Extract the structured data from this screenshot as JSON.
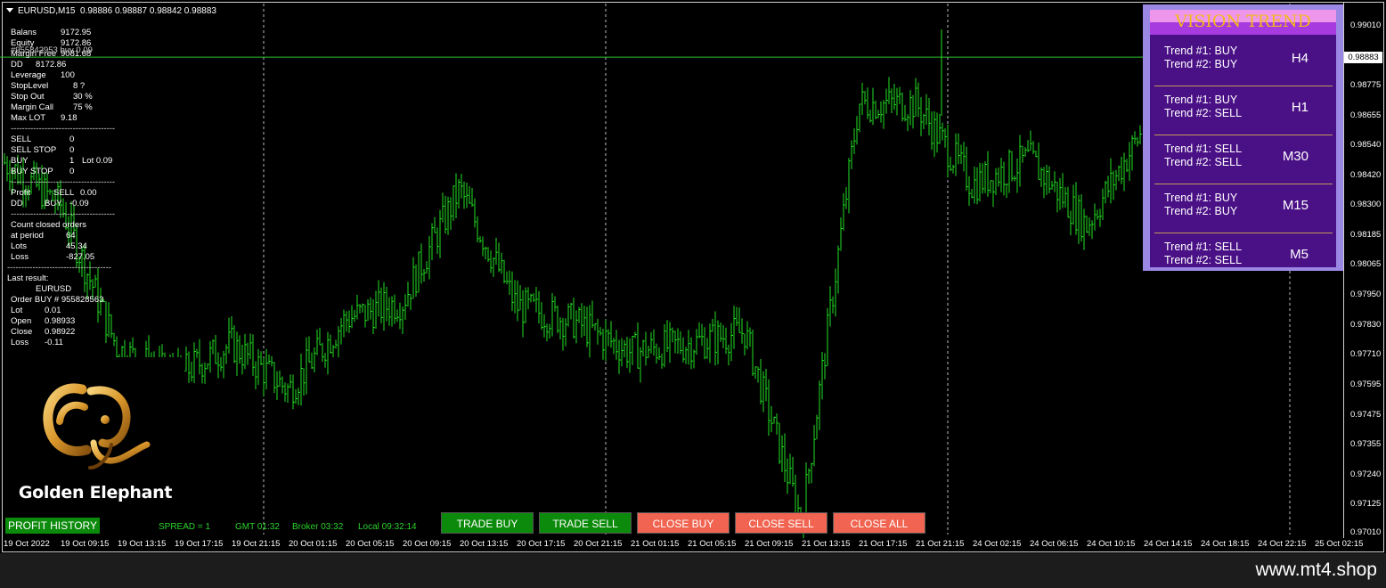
{
  "header": {
    "symbol": "EURUSD,M15",
    "quotes": "0.98886 0.98887 0.98842 0.98883"
  },
  "account": {
    "rows": [
      {
        "label": "Balans",
        "value": "9172.95"
      },
      {
        "label": "Equity",
        "value": "9172.86"
      },
      {
        "label": "Margin Free",
        "value": "9081.68"
      },
      {
        "label": "DD",
        "value": "8172.86"
      },
      {
        "label": "Leverage",
        "value": "100"
      },
      {
        "label": "StopLevel",
        "value": "8 ?"
      },
      {
        "label": "Stop Out",
        "value": "30 %"
      },
      {
        "label": "Margin Call",
        "value": "75 %"
      },
      {
        "label": "Max LOT",
        "value": "9.18"
      }
    ],
    "overlay_text": "#955842953 buy 0.09",
    "orders": [
      {
        "label": "SELL",
        "value": "0",
        "extra": ""
      },
      {
        "label": "SELL STOP",
        "value": "0",
        "extra": ""
      },
      {
        "label": "BUY",
        "value": "1",
        "extra": "Lot  0.09"
      },
      {
        "label": "BUY STOP",
        "value": "0",
        "extra": ""
      }
    ],
    "profit": {
      "label": "Profit",
      "side": "SELL",
      "value": "0.00"
    },
    "dd": {
      "label": "DD",
      "side": "BUY",
      "value": "-0.09"
    },
    "closed_title": "Count closed orders",
    "closed": [
      {
        "label": "at period",
        "value": "64"
      },
      {
        "label": "Lots",
        "value": "45.34"
      },
      {
        "label": "Loss",
        "value": "-827.05"
      }
    ],
    "last_title": "Last result:",
    "last_symbol": "EURUSD",
    "last_order": "Order  BUY   # 955828563",
    "last": [
      {
        "label": "Lot",
        "value": "0.01"
      },
      {
        "label": "Open",
        "value": "0.98933"
      },
      {
        "label": "Close",
        "value": "0.98922"
      },
      {
        "label": "Loss",
        "value": "-0.11"
      }
    ],
    "separator": "-------------------------------------"
  },
  "logo": {
    "text": "Golden Elephant",
    "gold": "#e0a430"
  },
  "bottom_bar": {
    "profit_history": "PROFIT HISTORY",
    "spread": "SPREAD = 1",
    "gmt": "GMT 01:32",
    "broker": "Broker 03:32",
    "local": "Local 09:32:14",
    "buttons": [
      "TRADE BUY",
      "TRADE SELL",
      "CLOSE BUY",
      "CLOSE SELL",
      "CLOSE ALL"
    ]
  },
  "vision_trend": {
    "title": "VISION TREND",
    "rows": [
      {
        "t1": "Trend #1: BUY",
        "t2": "Trend #2: BUY",
        "tf": "H4"
      },
      {
        "t1": "Trend #1: BUY",
        "t2": "Trend #2: SELL",
        "tf": "H1"
      },
      {
        "t1": "Trend #1: SELL",
        "t2": "Trend #2: SELL",
        "tf": "M30"
      },
      {
        "t1": "Trend #1: BUY",
        "t2": "Trend #2: BUY",
        "tf": "M15"
      },
      {
        "t1": "Trend #1: SELL",
        "t2": "Trend #2: SELL",
        "tf": "M5"
      }
    ]
  },
  "price_scale": {
    "labels": [
      "0.99010",
      "0.98883",
      "0.98775",
      "0.98655",
      "0.98540",
      "0.98420",
      "0.98300",
      "0.98185",
      "0.98065",
      "0.97950",
      "0.97830",
      "0.97710",
      "0.97595",
      "0.97475",
      "0.97355",
      "0.97240",
      "0.97125",
      "0.97010"
    ],
    "current": "0.98883"
  },
  "time_axis": {
    "labels": [
      "19 Oct 2022",
      "19 Oct 09:15",
      "19 Oct 13:15",
      "19 Oct 17:15",
      "19 Oct 21:15",
      "20 Oct 01:15",
      "20 Oct 05:15",
      "20 Oct 09:15",
      "20 Oct 13:15",
      "20 Oct 17:15",
      "20 Oct 21:15",
      "21 Oct 01:15",
      "21 Oct 05:15",
      "21 Oct 09:15",
      "21 Oct 13:15",
      "21 Oct 17:15",
      "21 Oct 21:15",
      "24 Oct 02:15",
      "24 Oct 06:15",
      "24 Oct 10:15",
      "24 Oct 14:15",
      "24 Oct 18:15",
      "24 Oct 22:15",
      "25 Oct 02:15"
    ]
  },
  "chart_data": {
    "type": "line",
    "symbol": "EURUSD",
    "timeframe": "M15",
    "x": [
      "19 Oct 2022",
      "19 Oct 09:15",
      "19 Oct 13:15",
      "19 Oct 17:15",
      "19 Oct 21:15",
      "20 Oct 01:15",
      "20 Oct 05:15",
      "20 Oct 09:15",
      "20 Oct 13:15",
      "20 Oct 17:15",
      "20 Oct 21:15",
      "21 Oct 01:15",
      "21 Oct 05:15",
      "21 Oct 09:15",
      "21 Oct 13:15",
      "21 Oct 17:15",
      "21 Oct 21:15",
      "24 Oct 02:15",
      "24 Oct 06:15",
      "24 Oct 10:15",
      "24 Oct 14:15"
    ],
    "y": [
      0.9847,
      0.983,
      0.9773,
      0.9762,
      0.9775,
      0.9757,
      0.9785,
      0.9792,
      0.9836,
      0.979,
      0.9784,
      0.9772,
      0.9775,
      0.978,
      0.9705,
      0.987,
      0.987,
      0.9838,
      0.9848,
      0.9822,
      0.986
    ],
    "ylim": [
      0.9701,
      0.9901
    ],
    "current_price": 0.98883,
    "vertical_separators": [
      "19 Oct 21:15",
      "20 Oct 21:15",
      "21 Oct 21:15",
      "24 Oct 22:15"
    ],
    "colors": {
      "candles": "#22e022",
      "background": "#000000",
      "price_line": "#22cc22"
    }
  },
  "footer": {
    "watermark": "www.mt4.shop"
  }
}
